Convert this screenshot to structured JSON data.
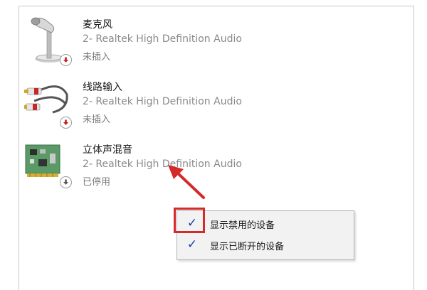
{
  "devices": [
    {
      "name": "麦克风",
      "driver": "2- Realtek High Definition Audio",
      "status": "未插入",
      "icon": "microphone-icon",
      "badge": "down-arrow-red"
    },
    {
      "name": "线路输入",
      "driver": "2- Realtek High Definition Audio",
      "status": "未插入",
      "icon": "rca-cable-icon",
      "badge": "down-arrow-red"
    },
    {
      "name": "立体声混音",
      "driver": "2- Realtek High Definition Audio",
      "status": "已停用",
      "icon": "sound-card-icon",
      "badge": "down-arrow-gray"
    }
  ],
  "context_menu": {
    "items": [
      {
        "label": "显示禁用的设备",
        "checked": true,
        "check_glyph": "✓"
      },
      {
        "label": "显示已断开的设备",
        "checked": true,
        "check_glyph": "✓"
      }
    ]
  },
  "colors": {
    "annotation_red": "#d42a2a",
    "check_blue": "#1a3fa8",
    "badge_red": "#c81e1e",
    "badge_gray": "#5a5a5a"
  }
}
